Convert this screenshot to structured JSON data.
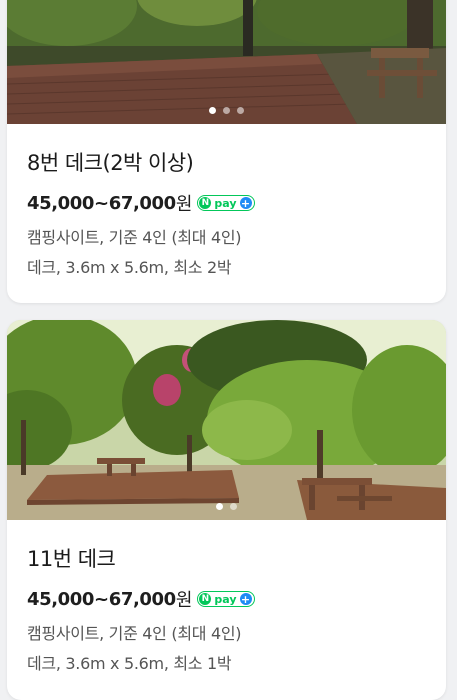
{
  "listings": [
    {
      "title": "8번 데크(2박 이상)",
      "price": "45,000~67,000",
      "currency": "원",
      "npay_badge": "pay",
      "site_info": "캠핑사이트, 기준 4인 (최대 4인)",
      "deck_info": "데크, 3.6m x 5.6m, 최소 2박",
      "photo_count": 3,
      "active_photo": 1
    },
    {
      "title": "11번 데크",
      "price": "45,000~67,000",
      "currency": "원",
      "npay_badge": "pay",
      "site_info": "캠핑사이트, 기준 4인 (최대 4인)",
      "deck_info": "데크, 3.6m x 5.6m, 최소 1박",
      "photo_count": 2,
      "active_photo": 1
    }
  ],
  "colors": {
    "npay_green": "#03c75a",
    "npay_plus_blue": "#1e8bf5"
  }
}
